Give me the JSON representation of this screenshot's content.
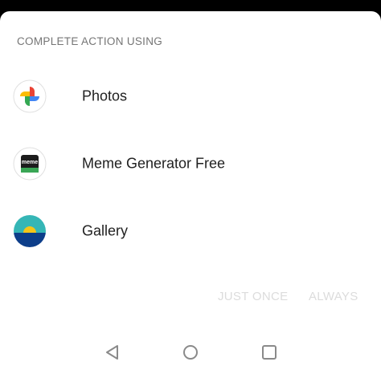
{
  "sheet": {
    "title": "COMPLETE ACTION USING"
  },
  "apps": [
    {
      "label": "Photos",
      "icon": "google-photos-pinwheel-icon"
    },
    {
      "label": "Meme Generator Free",
      "icon": "meme-generator-icon"
    },
    {
      "label": "Gallery",
      "icon": "gallery-sunset-icon"
    }
  ],
  "meme_icon_text": "meme",
  "actions": {
    "just_once": "JUST ONCE",
    "always": "ALWAYS",
    "disabled_color": "#dcdcdc"
  },
  "nav": {
    "back": "back-triangle-icon",
    "home": "home-circle-icon",
    "recents": "recents-square-icon"
  },
  "colors": {
    "background": "#ffffff",
    "text_primary": "#212121",
    "text_secondary": "#757575"
  }
}
